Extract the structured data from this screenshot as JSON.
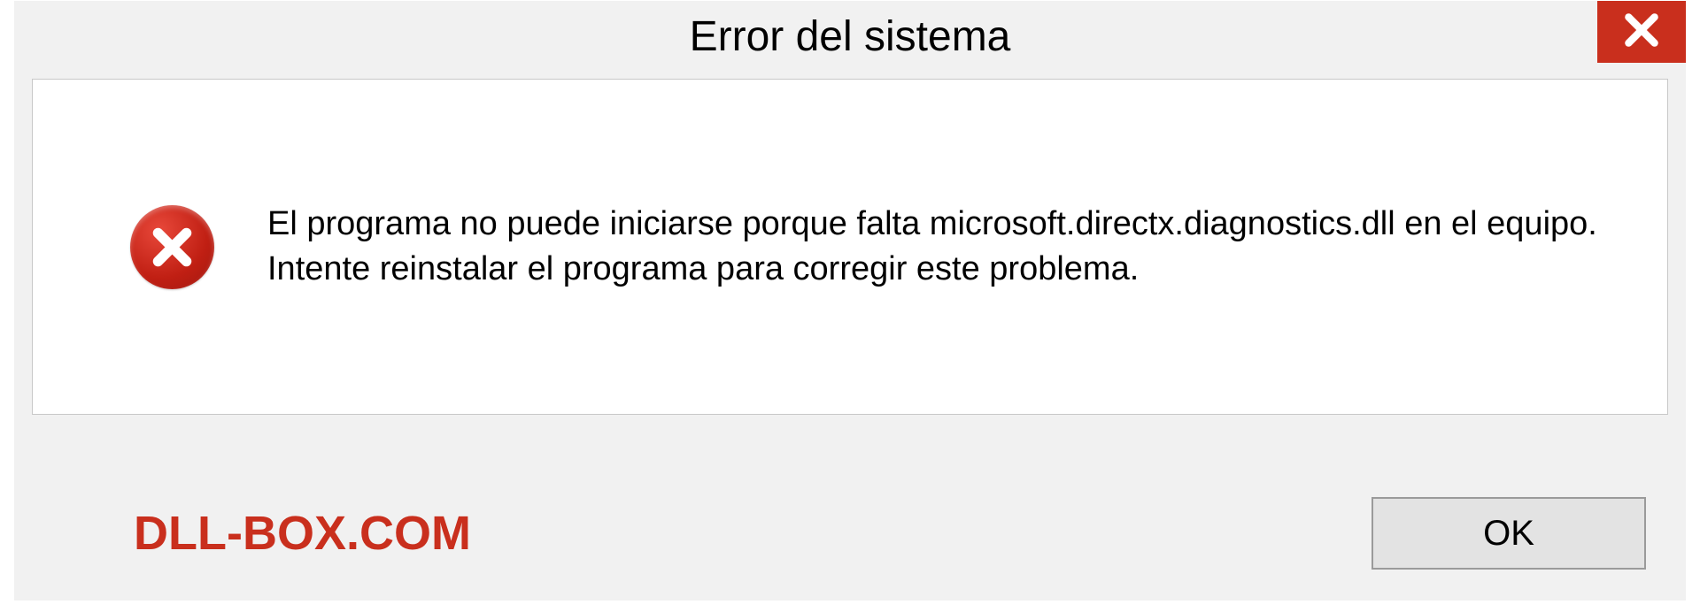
{
  "dialog": {
    "title": "Error del sistema",
    "message": "El programa no puede iniciarse porque falta microsoft.directx.diagnostics.dll en el equipo. Intente reinstalar el programa para corregir este problema.",
    "ok_label": "OK"
  },
  "watermark": "DLL-BOX.COM"
}
